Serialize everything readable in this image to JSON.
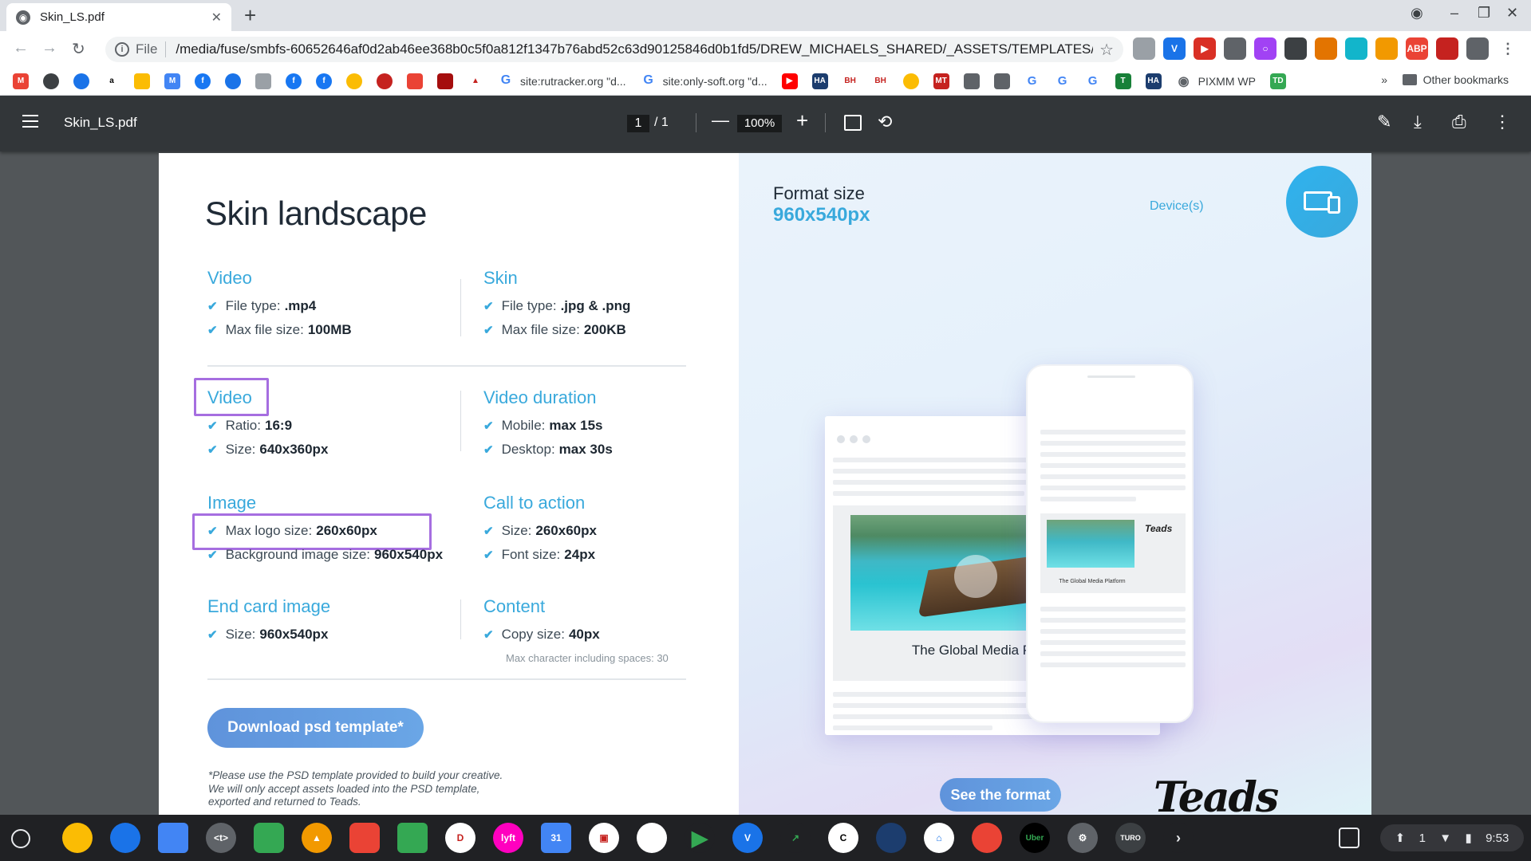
{
  "browser": {
    "tab_title": "Skin_LS.pdf",
    "new_tab_icon": "+",
    "scheme_label": "File",
    "url": "/media/fuse/smbfs-60652646af0d2ab46ee368b0c5f0a812f1347b76abd52c63d90125846d0b1fd5/DREW_MICHAELS_SHARED/_ASSETS/TEMPLATES/Sk...",
    "bookmark_texts": [
      "site:rutracker.org \"d...",
      "site:only-soft.org \"d...",
      "PIXMM WP"
    ],
    "bookmark_overflow": "»",
    "other_bookmarks": "Other bookmarks"
  },
  "pdf_toolbar": {
    "file_name": "Skin_LS.pdf",
    "current_page": "1",
    "page_total": "/ 1",
    "zoom": "100%",
    "zoom_out": "—",
    "zoom_in": "+"
  },
  "document": {
    "title": "Skin landscape",
    "sections": {
      "video1": {
        "heading": "Video",
        "items": [
          {
            "label": "File type:",
            "value": ".mp4"
          },
          {
            "label": "Max file size:",
            "value": "100MB"
          }
        ]
      },
      "skin": {
        "heading": "Skin",
        "items": [
          {
            "label": "File type:",
            "value": ".jpg & .png"
          },
          {
            "label": "Max file size:",
            "value": "200KB"
          }
        ]
      },
      "video2": {
        "heading": "Video",
        "items": [
          {
            "label": "Ratio:",
            "value": "16:9"
          },
          {
            "label": "Size:",
            "value": "640x360px"
          }
        ]
      },
      "video_duration": {
        "heading": "Video duration",
        "items": [
          {
            "label": "Mobile:",
            "value": "max 15s"
          },
          {
            "label": "Desktop:",
            "value": "max 30s"
          }
        ]
      },
      "image": {
        "heading": "Image",
        "items": [
          {
            "label": "Max logo size:",
            "value": "260x60px"
          },
          {
            "label": "Background image size:",
            "value": "960x540px"
          }
        ]
      },
      "cta": {
        "heading": "Call to action",
        "items": [
          {
            "label": "Size:",
            "value": "260x60px"
          },
          {
            "label": "Font size:",
            "value": "24px"
          }
        ]
      },
      "end_card": {
        "heading": "End card image",
        "items": [
          {
            "label": "Size:",
            "value": "960x540px"
          }
        ]
      },
      "content": {
        "heading": "Content",
        "items": [
          {
            "label": "Copy size:",
            "value": "40px"
          }
        ],
        "note": "Max character including spaces: 30"
      }
    },
    "download_button": "Download psd template*",
    "footnote": [
      "*Please use the PSD template provided to build your creative.",
      "We will only accept assets loaded into the PSD template,",
      "exported and returned to Teads."
    ],
    "format_size_label": "Format size",
    "format_size_value": "960x540px",
    "devices_link": "Device(s)",
    "ad_caption": "The Global Media Platform",
    "phone_ad_logo": "Teads",
    "phone_ad_caption": "The Global Media Platform",
    "see_format_button": "See the format",
    "brand_logo": "Teads"
  },
  "shelf": {
    "tray_notifications": "1",
    "time": "9:53"
  },
  "colors": {
    "accent": "#39a9dc",
    "highlight_box": "#a66ee0",
    "button_gradient_start": "#5f93db",
    "pdf_toolbar": "#323639",
    "pdf_background": "#525659"
  }
}
